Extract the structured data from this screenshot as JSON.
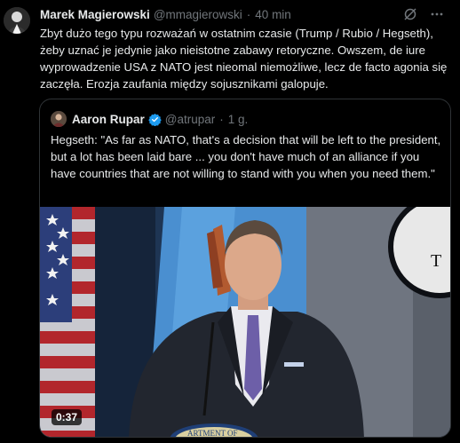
{
  "tweet": {
    "author_name": "Marek Magierowski",
    "author_handle": "@mmagierowski",
    "separator": "·",
    "time": "40 min",
    "text": "Zbyt dużo tego typu rozważań w ostatnim czasie (Trump / Rubio / Hegseth), żeby uznać je jedynie jako nieistotne zabawy retoryczne. Owszem, de iure wyprowadzenie USA z NATO jest nieomal niemożliwe, lecz de facto agonia się zaczęła. Erozja zaufania między sojusznikami galopuje."
  },
  "quote": {
    "author_name": "Aaron Rupar",
    "author_handle": "@atrupar",
    "separator": "·",
    "time": "1 g.",
    "text": "Hegseth: \"As far as NATO, that's a decision that will be left to the president, but a lot has been laid bare ... you don't have much of an alliance if you have countries that are not willing to stand with you when you need them.\"",
    "video_duration": "0:37",
    "seal_text": "ARTMENT OF",
    "sign_letter": "T"
  },
  "colors": {
    "background": "#000000",
    "text": "#e7e9ea",
    "muted": "#71767b",
    "border": "#2f3336",
    "verified": "#1d9bf0"
  },
  "icons": [
    "grok-icon",
    "more-icon",
    "verified-badge-icon"
  ]
}
